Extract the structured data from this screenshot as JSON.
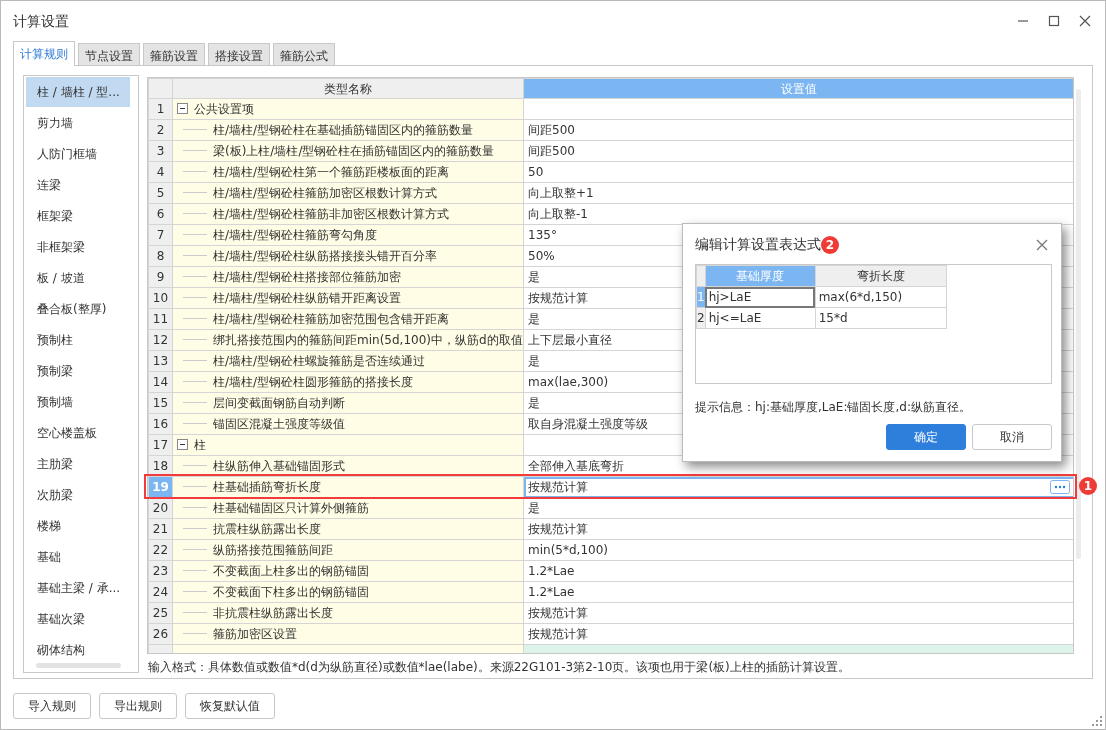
{
  "window": {
    "title": "计算设置"
  },
  "tabs": [
    {
      "label": "计算规则",
      "selected": true
    },
    {
      "label": "节点设置",
      "selected": false
    },
    {
      "label": "箍筋设置",
      "selected": false
    },
    {
      "label": "搭接设置",
      "selected": false
    },
    {
      "label": "箍筋公式",
      "selected": false
    }
  ],
  "sidebar": {
    "items": [
      {
        "label": "柱 / 墙柱 / 型...",
        "selected": true
      },
      {
        "label": "剪力墙",
        "selected": false
      },
      {
        "label": "人防门框墙",
        "selected": false
      },
      {
        "label": "连梁",
        "selected": false
      },
      {
        "label": "框架梁",
        "selected": false
      },
      {
        "label": "非框架梁",
        "selected": false
      },
      {
        "label": "板 / 坡道",
        "selected": false
      },
      {
        "label": "叠合板(整厚)",
        "selected": false
      },
      {
        "label": "预制柱",
        "selected": false
      },
      {
        "label": "预制梁",
        "selected": false
      },
      {
        "label": "预制墙",
        "selected": false
      },
      {
        "label": "空心楼盖板",
        "selected": false
      },
      {
        "label": "主肋梁",
        "selected": false
      },
      {
        "label": "次肋梁",
        "selected": false
      },
      {
        "label": "楼梯",
        "selected": false
      },
      {
        "label": "基础",
        "selected": false
      },
      {
        "label": "基础主梁 / 承...",
        "selected": false
      },
      {
        "label": "基础次梁",
        "selected": false
      },
      {
        "label": "砌体结构",
        "selected": false
      }
    ]
  },
  "grid": {
    "columns": [
      {
        "label": "类型名称",
        "selected": false
      },
      {
        "label": "设置值",
        "selected": true
      }
    ],
    "groups": [
      {
        "number": "1",
        "label": "公共设置项",
        "expanded": true,
        "rows": [
          {
            "number": "2",
            "name": "柱/墙柱/型钢砼柱在基础插筋锚固区内的箍筋数量",
            "value": "间距500",
            "selected": false
          },
          {
            "number": "3",
            "name": "梁(板)上柱/墙柱/型钢砼柱在插筋锚固区内的箍筋数量",
            "value": "间距500",
            "selected": false
          },
          {
            "number": "4",
            "name": "柱/墙柱/型钢砼柱第一个箍筋距楼板面的距离",
            "value": "50",
            "selected": false
          },
          {
            "number": "5",
            "name": "柱/墙柱/型钢砼柱箍筋加密区根数计算方式",
            "value": "向上取整+1",
            "selected": false
          },
          {
            "number": "6",
            "name": "柱/墙柱/型钢砼柱箍筋非加密区根数计算方式",
            "value": "向上取整-1",
            "selected": false
          },
          {
            "number": "7",
            "name": "柱/墙柱/型钢砼柱箍筋弯勾角度",
            "value": "135°",
            "selected": false
          },
          {
            "number": "8",
            "name": "柱/墙柱/型钢砼柱纵筋搭接接头错开百分率",
            "value": "50%",
            "selected": false
          },
          {
            "number": "9",
            "name": "柱/墙柱/型钢砼柱搭接部位箍筋加密",
            "value": "是",
            "selected": false
          },
          {
            "number": "10",
            "name": "柱/墙柱/型钢砼柱纵筋错开距离设置",
            "value": "按规范计算",
            "selected": false
          },
          {
            "number": "11",
            "name": "柱/墙柱/型钢砼柱箍筋加密范围包含错开距离",
            "value": "是",
            "selected": false
          },
          {
            "number": "12",
            "name": "绑扎搭接范围内的箍筋间距min(5d,100)中，纵筋d的取值",
            "value": "上下层最小直径",
            "selected": false
          },
          {
            "number": "13",
            "name": "柱/墙柱/型钢砼柱螺旋箍筋是否连续通过",
            "value": "是",
            "selected": false
          },
          {
            "number": "14",
            "name": "柱/墙柱/型钢砼柱圆形箍筋的搭接长度",
            "value": "max(lae,300)",
            "selected": false
          },
          {
            "number": "15",
            "name": "层间变截面钢筋自动判断",
            "value": "是",
            "selected": false
          },
          {
            "number": "16",
            "name": "锚固区混凝土强度等级值",
            "value": "取自身混凝土强度等级",
            "selected": false
          }
        ]
      },
      {
        "number": "17",
        "label": "柱",
        "expanded": true,
        "rows": [
          {
            "number": "18",
            "name": "柱纵筋伸入基础锚固形式",
            "value": "全部伸入基底弯折",
            "selected": false
          },
          {
            "number": "19",
            "name": "柱基础插筋弯折长度",
            "value": "按规范计算",
            "selected": true,
            "marker": "1"
          },
          {
            "number": "20",
            "name": "柱基础锚固区只计算外侧箍筋",
            "value": "是",
            "selected": false
          },
          {
            "number": "21",
            "name": "抗震柱纵筋露出长度",
            "value": "按规范计算",
            "selected": false
          },
          {
            "number": "22",
            "name": "纵筋搭接范围箍筋间距",
            "value": "min(5*d,100)",
            "selected": false
          },
          {
            "number": "23",
            "name": "不变截面上柱多出的钢筋锚固",
            "value": "1.2*Lae",
            "selected": false
          },
          {
            "number": "24",
            "name": "不变截面下柱多出的钢筋锚固",
            "value": "1.2*Lae",
            "selected": false
          },
          {
            "number": "25",
            "name": "非抗震柱纵筋露出长度",
            "value": "按规范计算",
            "selected": false
          },
          {
            "number": "26",
            "name": "箍筋加密区设置",
            "value": "按规范计算",
            "selected": false
          }
        ]
      }
    ]
  },
  "note": "输入格式：具体数值或数值*d(d为纵筋直径)或数值*lae(labe)。来源22G101-3第2-10页。该项也用于梁(板)上柱的插筋计算设置。",
  "buttons": [
    "导入规则",
    "导出规则",
    "恢复默认值"
  ],
  "dialog": {
    "title": "编辑计算设置表达式",
    "marker": "2",
    "columns": [
      {
        "label": "基础厚度",
        "selected": true
      },
      {
        "label": "弯折长度",
        "selected": false
      }
    ],
    "rows": [
      {
        "number": "1",
        "cells": [
          "hj>LaE",
          "max(6*d,150)"
        ],
        "selected": true
      },
      {
        "number": "2",
        "cells": [
          "hj<=LaE",
          "15*d"
        ],
        "selected": false
      }
    ],
    "hint": "提示信息：hj:基础厚度,LaE:锚固长度,d:纵筋直径。",
    "buttons": [
      {
        "label": "确定",
        "kind": "primary"
      },
      {
        "label": "取消",
        "kind": "secondary"
      }
    ]
  }
}
